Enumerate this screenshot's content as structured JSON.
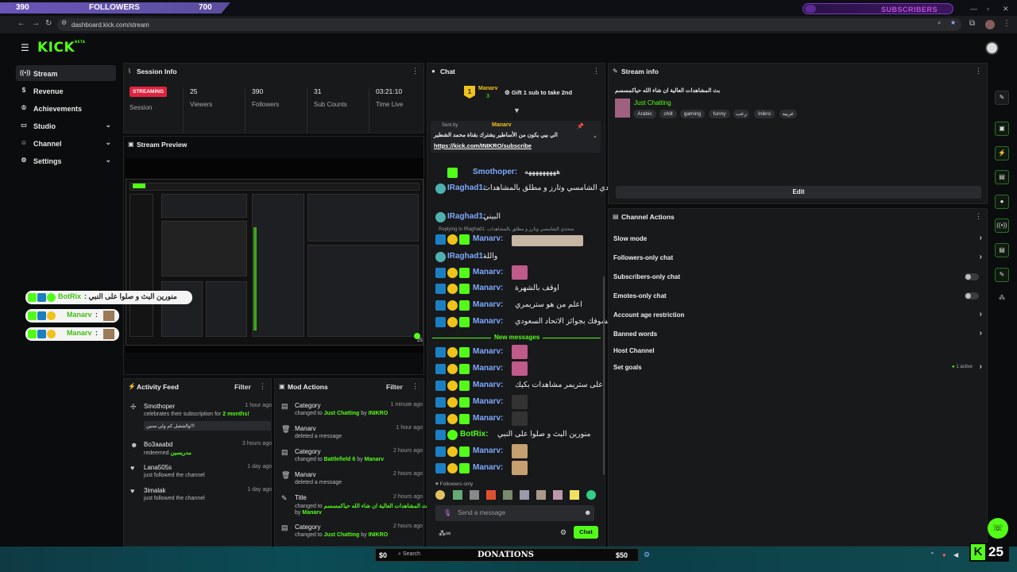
{
  "overlay": {
    "follower_current": "390",
    "follower_label": "FOLLOWERS",
    "follower_goal": "700",
    "subscribers_label": "SUBSCRIBERS"
  },
  "browser": {
    "url": "dashboard.kick.com/stream"
  },
  "brand": {
    "logo_text": "KICK",
    "logo_tag": "BETA",
    "accent": "#53fc18"
  },
  "sidebar": {
    "items": [
      {
        "label": "Stream",
        "icon": "broadcast-icon"
      },
      {
        "label": "Revenue",
        "icon": "dollar-icon"
      },
      {
        "label": "Achievements",
        "icon": "trophy-icon"
      },
      {
        "label": "Studio",
        "icon": "studio-icon"
      },
      {
        "label": "Channel",
        "icon": "user-icon"
      },
      {
        "label": "Settings",
        "icon": "gear-icon"
      }
    ]
  },
  "session": {
    "title": "Session Info",
    "status": "STREAMING",
    "status_label": "Session",
    "stats": [
      {
        "value": "25",
        "label": "Viewers"
      },
      {
        "value": "390",
        "label": "Followers"
      },
      {
        "value": "31",
        "label": "Sub Counts"
      },
      {
        "value": "03:21:10",
        "label": "Time Live"
      }
    ]
  },
  "preview": {
    "title": "Stream Preview",
    "viewer_count": "25"
  },
  "overlay_chat": [
    {
      "user": "BotRix",
      "text": ": منورين البث و صلوا على النبي"
    },
    {
      "user": "Manarv",
      "text": ":"
    },
    {
      "user": "Manarv",
      "text": ":"
    }
  ],
  "activity": {
    "title": "Activity Feed",
    "filter": "Filter",
    "items": [
      {
        "name": "Smothoper",
        "text_pre": "celebrates their subscription for",
        "highlight": "2 months!",
        "time": "1 hour ago",
        "note": "والشغيل كم ولي سنين!!!"
      },
      {
        "name": "Bo3aaabd",
        "text_pre": "redeemed",
        "highlight": "مدريسين",
        "time": "3 hours ago"
      },
      {
        "name": "Lana505s",
        "text_pre": "just followed the channel",
        "highlight": "",
        "time": "1 day ago"
      },
      {
        "name": "3imalak",
        "text_pre": "just followed the channel",
        "highlight": "",
        "time": "1 day ago"
      }
    ]
  },
  "mod": {
    "title": "Mod Actions",
    "filter": "Filter",
    "items": [
      {
        "name": "Category",
        "text_pre": "changed to",
        "highlight": "Just Chatting",
        "by": "by",
        "actor": "INIKRO",
        "time": "1 minute ago"
      },
      {
        "name": "Manarv",
        "text_pre": "deleted a message",
        "highlight": "",
        "by": "",
        "actor": "",
        "time": "1 hour ago"
      },
      {
        "name": "Category",
        "text_pre": "changed to",
        "highlight": "Battlefield 6",
        "by": "by",
        "actor": "Manarv",
        "time": "2 hours ago"
      },
      {
        "name": "Manarv",
        "text_pre": "deleted a message",
        "highlight": "",
        "by": "",
        "actor": "",
        "time": "2 hours ago"
      },
      {
        "name": "Title",
        "text_pre": "changed to",
        "highlight": "بث المشاهدات العالية ان شاء الله حياكمسسم",
        "by": "by",
        "actor": "Manarv",
        "time": "2 hours ago"
      },
      {
        "name": "Category",
        "text_pre": "changed to",
        "highlight": "Just Chatting",
        "by": "by",
        "actor": "INIKRO",
        "time": "2 hours ago"
      }
    ]
  },
  "chat": {
    "title": "Chat",
    "gifter": "Manarv",
    "gifter_count": "3",
    "gift_text": "Gift 1 sub to take 2nd",
    "pinned_sender_label": "Sent by",
    "pinned_sender": "Manarv",
    "pinned_text": "الي بيي يكون من الأساطير يشترك بقناة محمد الشطير",
    "pinned_link": "https://kick.com/INIKRO/subscribe",
    "reply_to": "Replying to IRaghad1: متحدي الشامسي وتارز و مطلق بالمشاهدات",
    "new_messages": "New messages",
    "messages": [
      {
        "user": "Smothoper:",
        "text": "هههههههههه"
      },
      {
        "user": "IRaghad1:",
        "text": "متحدي الشامسي وتارز و مطلق بالمشاهدات"
      },
      {
        "user": "IRaghad1:",
        "text": "البيني"
      },
      {
        "user": "Manarv:",
        "text": ""
      },
      {
        "user": "IRaghad1:",
        "text": "والله"
      },
      {
        "user": "Manarv:",
        "text": ""
      },
      {
        "user": "Manarv:",
        "text": "اوقف بالشهرة"
      },
      {
        "user": "Manarv:",
        "text": "اعلم من هو ستريمري"
      },
      {
        "user": "Manarv:",
        "text": "بنشوفك بجوائز الاتحاد السعودي"
      },
      {
        "user": "Manarv:",
        "text": ""
      },
      {
        "user": "Manarv:",
        "text": ""
      },
      {
        "user": "Manarv:",
        "text": "اعلى ستريمر مشاهدات بكيك"
      },
      {
        "user": "Manarv:",
        "text": ""
      },
      {
        "user": "Manarv:",
        "text": ""
      },
      {
        "user": "BotRix:",
        "text": "منورين البث و صلوا على النبي"
      },
      {
        "user": "Manarv:",
        "text": ""
      },
      {
        "user": "Manarv:",
        "text": ""
      }
    ],
    "followers_only": "Followers only",
    "input_placeholder": "Send a message",
    "send_label": "Chat"
  },
  "stream_info": {
    "title": "Stream info",
    "stream_title": "بث المشاهدات العالية ان شاء الله حياكمسسم",
    "category": "Just Chatting",
    "tags": [
      "Arabic",
      "chill",
      "gaming",
      "funny",
      "رعب",
      "Inikro",
      "عربيه"
    ],
    "edit_label": "Edit"
  },
  "channel_actions": {
    "title": "Channel Actions",
    "items": [
      {
        "label": "Slow mode",
        "control": "chevron"
      },
      {
        "label": "Followers-only chat",
        "control": "chevron"
      },
      {
        "label": "Subscribers-only chat",
        "control": "toggle"
      },
      {
        "label": "Emotes-only chat",
        "control": "toggle"
      },
      {
        "label": "Account age restriction",
        "control": "chevron"
      },
      {
        "label": "Banned words",
        "control": "chevron"
      },
      {
        "label": "Host Channel",
        "control": "none"
      },
      {
        "label": "Set goals",
        "control": "chevron"
      }
    ],
    "goals_status": "1 active"
  },
  "taskbar": {
    "search": "Search",
    "donations_label": "DONATIONS",
    "donations_left": "$0",
    "donations_right": "$50",
    "viewer_badge": "25"
  }
}
